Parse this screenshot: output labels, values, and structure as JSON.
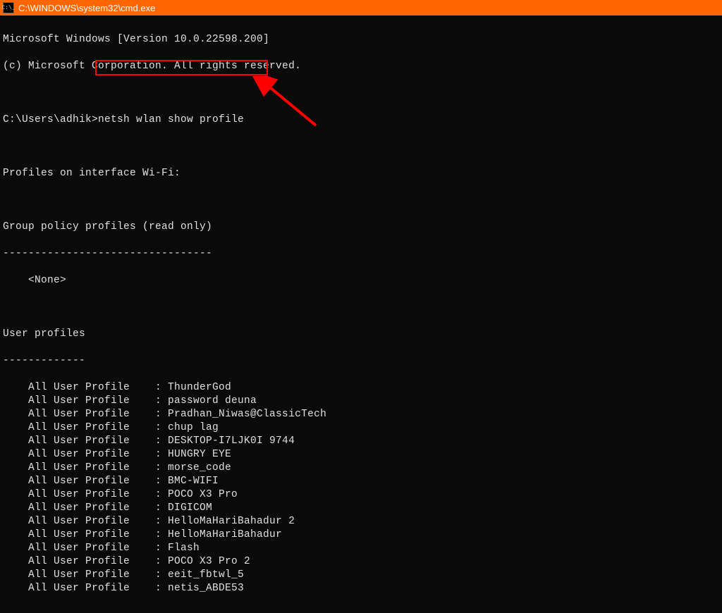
{
  "title_bar": {
    "icon_text": "C:\\_",
    "title": "C:\\WINDOWS\\system32\\cmd.exe"
  },
  "annotation": {
    "highlight_color": "#ff0000",
    "arrow_color": "#ff0000"
  },
  "terminal": {
    "version_line": "Microsoft Windows [Version 10.0.22598.200]",
    "copyright_line": "(c) Microsoft Corporation. All rights reserved.",
    "prompt": "C:\\Users\\adhik>",
    "command": "netsh wlan show profile",
    "interface_header": "Profiles on interface Wi-Fi:",
    "group_policy_header": "Group policy profiles (read only)",
    "group_policy_sep": "---------------------------------",
    "group_policy_value": "    <None>",
    "user_profiles_header": "User profiles",
    "user_profiles_sep": "-------------",
    "profile_label": "All User Profile",
    "profiles": [
      "ThunderGod",
      "password deuna",
      "Pradhan_Niwas@ClassicTech",
      "chup lag",
      "DESKTOP-I7LJK0I 9744",
      "HUNGRY EYE",
      "morse_code",
      "BMC-WIFI",
      "POCO X3 Pro",
      "DIGICOM",
      "HelloMaHariBahadur 2",
      "HelloMaHariBahadur",
      "Flash",
      "POCO X3 Pro 2",
      "eeit_fbtwl_5",
      "netis_ABDE53"
    ]
  }
}
